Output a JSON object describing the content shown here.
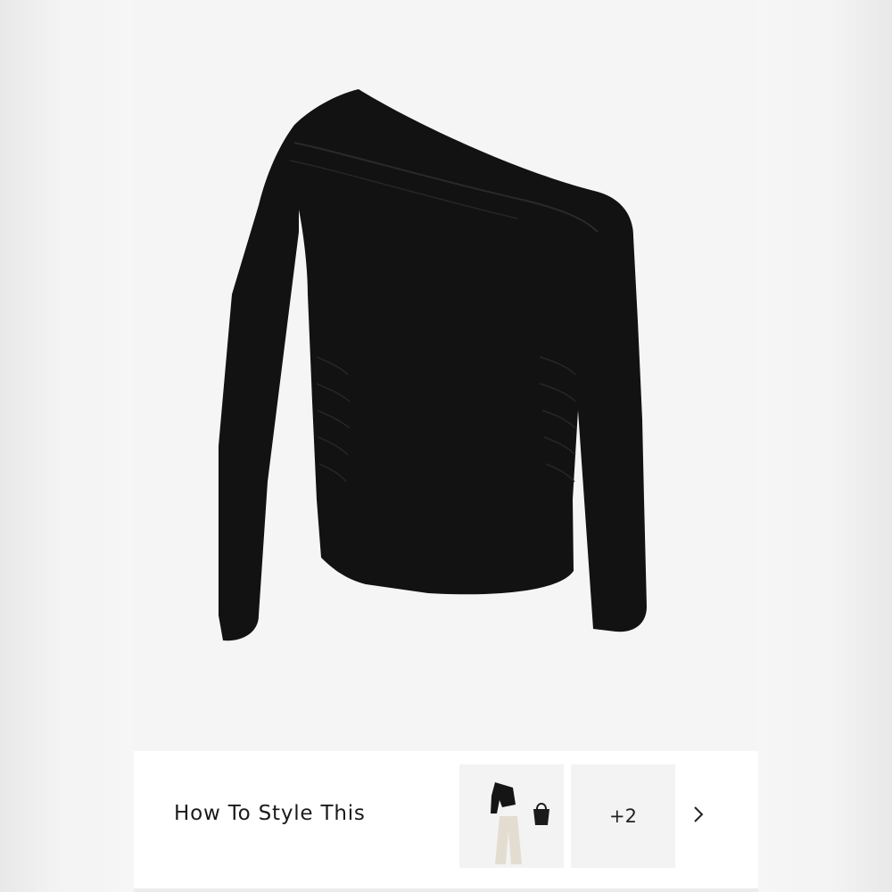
{
  "product": {
    "image_alt": "Black asymmetric one-shoulder long-sleeve ruched top",
    "colors": {
      "garment": "#121212",
      "background": "#f5f5f5"
    }
  },
  "style_section": {
    "title": "How To Style This",
    "thumbnails": [
      {
        "icon": "outfit-thumbnail"
      },
      {
        "more_label": "+2"
      }
    ],
    "next_icon": "chevron-right-icon"
  }
}
